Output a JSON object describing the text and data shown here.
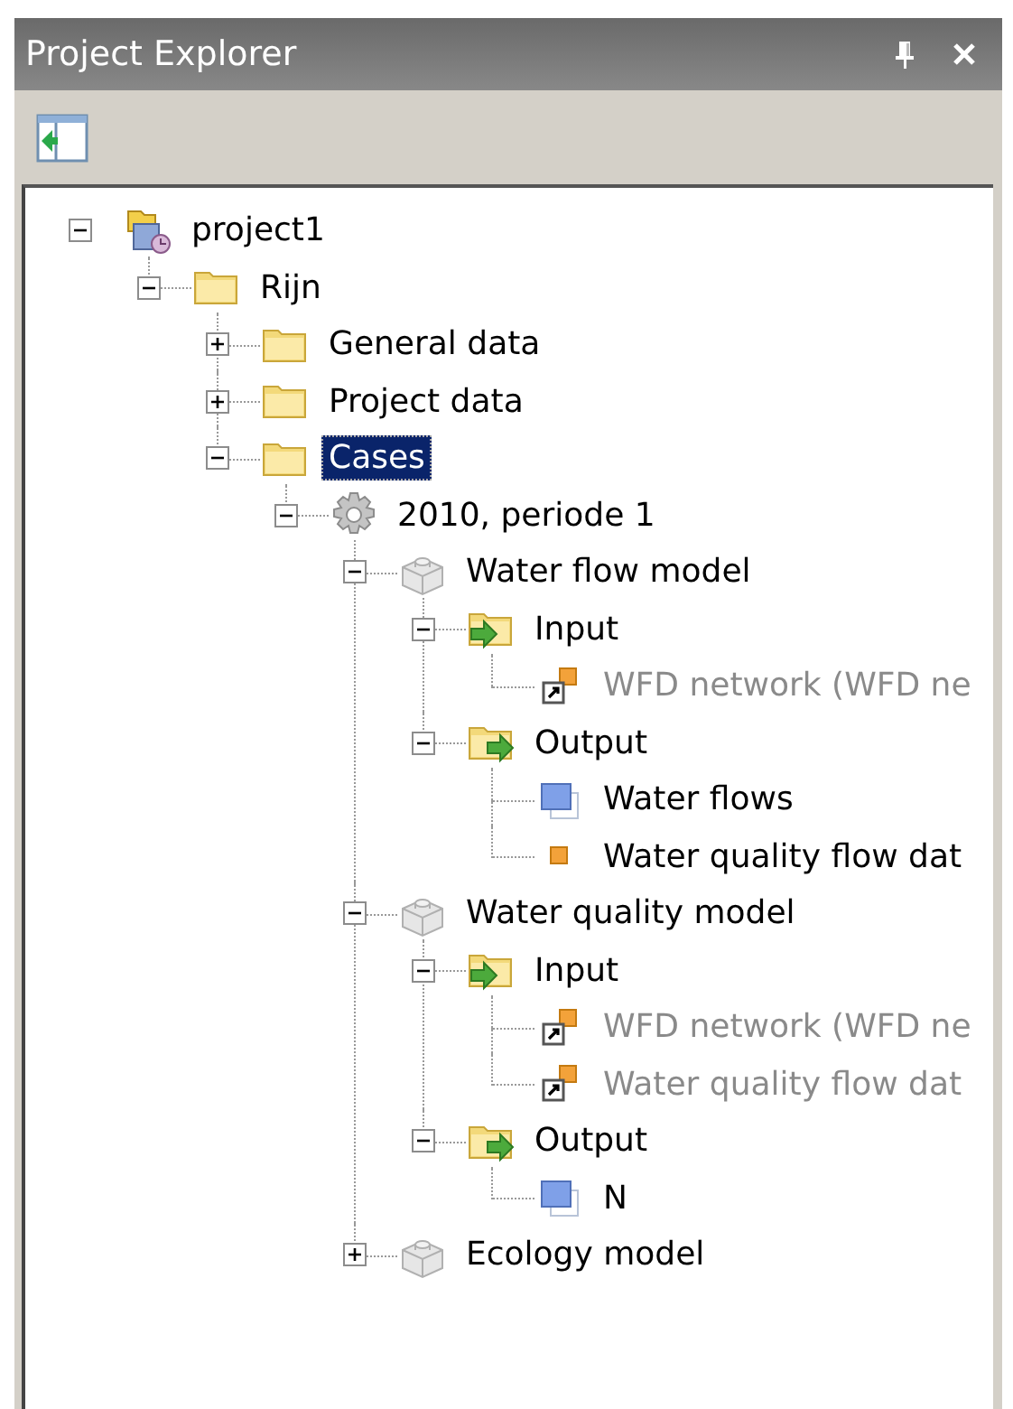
{
  "panel": {
    "title": "Project Explorer"
  },
  "tree": [
    {
      "label": "project1",
      "kind": "project",
      "selected": false,
      "expanded": true,
      "children": [
        {
          "label": "Rijn",
          "kind": "folder",
          "selected": false,
          "expanded": true,
          "children": [
            {
              "label": "General data",
              "kind": "folder",
              "selected": false,
              "expanded": false
            },
            {
              "label": "Project data",
              "kind": "folder",
              "selected": false,
              "expanded": false
            },
            {
              "label": "Cases",
              "kind": "folder",
              "selected": true,
              "expanded": true,
              "children": [
                {
                  "label": "2010, periode 1",
                  "kind": "case",
                  "selected": false,
                  "expanded": true,
                  "children": [
                    {
                      "label": "Water flow model",
                      "kind": "model",
                      "selected": false,
                      "expanded": true,
                      "children": [
                        {
                          "label": "Input",
                          "kind": "input",
                          "selected": false,
                          "expanded": true,
                          "children": [
                            {
                              "label": "WFD network (WFD ne",
                              "kind": "link",
                              "selected": false
                            }
                          ]
                        },
                        {
                          "label": "Output",
                          "kind": "output",
                          "selected": false,
                          "expanded": true,
                          "children": [
                            {
                              "label": "Water flows",
                              "kind": "grid",
                              "selected": false
                            },
                            {
                              "label": "Water quality flow dat",
                              "kind": "point",
                              "selected": false
                            }
                          ]
                        }
                      ]
                    },
                    {
                      "label": "Water quality model",
                      "kind": "model",
                      "selected": false,
                      "expanded": true,
                      "children": [
                        {
                          "label": "Input",
                          "kind": "input",
                          "selected": false,
                          "expanded": true,
                          "children": [
                            {
                              "label": "WFD network (WFD ne",
                              "kind": "link",
                              "selected": false
                            },
                            {
                              "label": "Water quality flow dat",
                              "kind": "link",
                              "selected": false
                            }
                          ]
                        },
                        {
                          "label": "Output",
                          "kind": "output",
                          "selected": false,
                          "expanded": true,
                          "children": [
                            {
                              "label": "N",
                              "kind": "grid",
                              "selected": false
                            }
                          ]
                        }
                      ]
                    },
                    {
                      "label": "Ecology model",
                      "kind": "model",
                      "selected": false,
                      "expanded": false
                    }
                  ]
                }
              ]
            }
          ]
        }
      ]
    }
  ]
}
